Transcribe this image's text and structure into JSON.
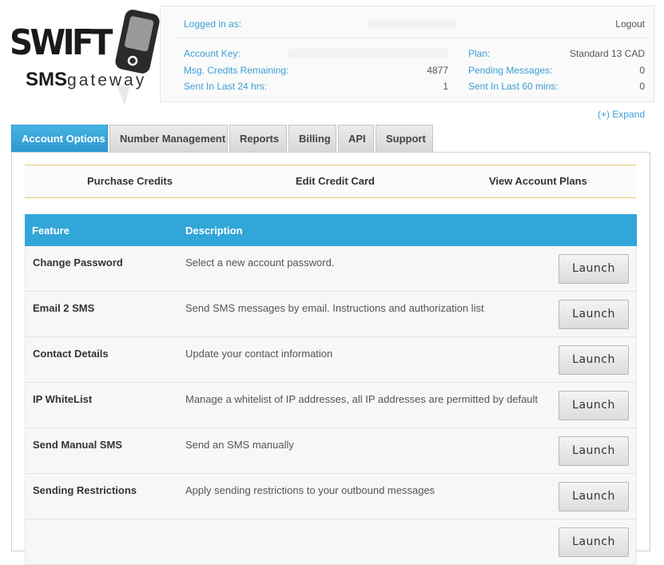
{
  "logo": {
    "word": "SWIFT",
    "sub_bold": "SMS",
    "sub_light": "gateway"
  },
  "account": {
    "logged_in_label": "Logged in as:",
    "logout_label": "Logout",
    "key_label": "Account Key:",
    "credits_label": "Msg. Credits Remaining:",
    "credits_value": "4877",
    "sent24_label": "Sent In Last 24 hrs:",
    "sent24_value": "1",
    "plan_label": "Plan:",
    "plan_value": "Standard 13 CAD",
    "pending_label": "Pending Messages:",
    "pending_value": "0",
    "sent60_label": "Sent In Last 60 mins:",
    "sent60_value": "0"
  },
  "expand_label": "(+) Expand",
  "tabs": [
    {
      "label": "Account Options",
      "active": true
    },
    {
      "label": "Number Management",
      "active": false
    },
    {
      "label": "Reports",
      "active": false
    },
    {
      "label": "Billing",
      "active": false
    },
    {
      "label": "API",
      "active": false
    },
    {
      "label": "Support",
      "active": false
    }
  ],
  "subnav": [
    "Purchase Credits",
    "Edit Credit Card",
    "View Account Plans"
  ],
  "table": {
    "headers": [
      "Feature",
      "Description"
    ],
    "launch_label": "Launch",
    "rows": [
      {
        "feature": "Change Password",
        "description": "Select a new account password."
      },
      {
        "feature": "Email 2 SMS",
        "description": "Send SMS messages by email. Instructions and authorization list"
      },
      {
        "feature": "Contact Details",
        "description": "Update your contact information"
      },
      {
        "feature": "IP WhiteList",
        "description": "Manage a whitelist of IP addresses, all IP addresses are permitted by default"
      },
      {
        "feature": "Send Manual SMS",
        "description": "Send an SMS manually"
      },
      {
        "feature": "Sending Restrictions",
        "description": "Apply sending restrictions to your outbound messages"
      },
      {
        "feature": "",
        "description": ""
      }
    ]
  },
  "colors": {
    "accent": "#32a6d8",
    "link": "#3a9fd5",
    "divider": "#e3c374"
  }
}
